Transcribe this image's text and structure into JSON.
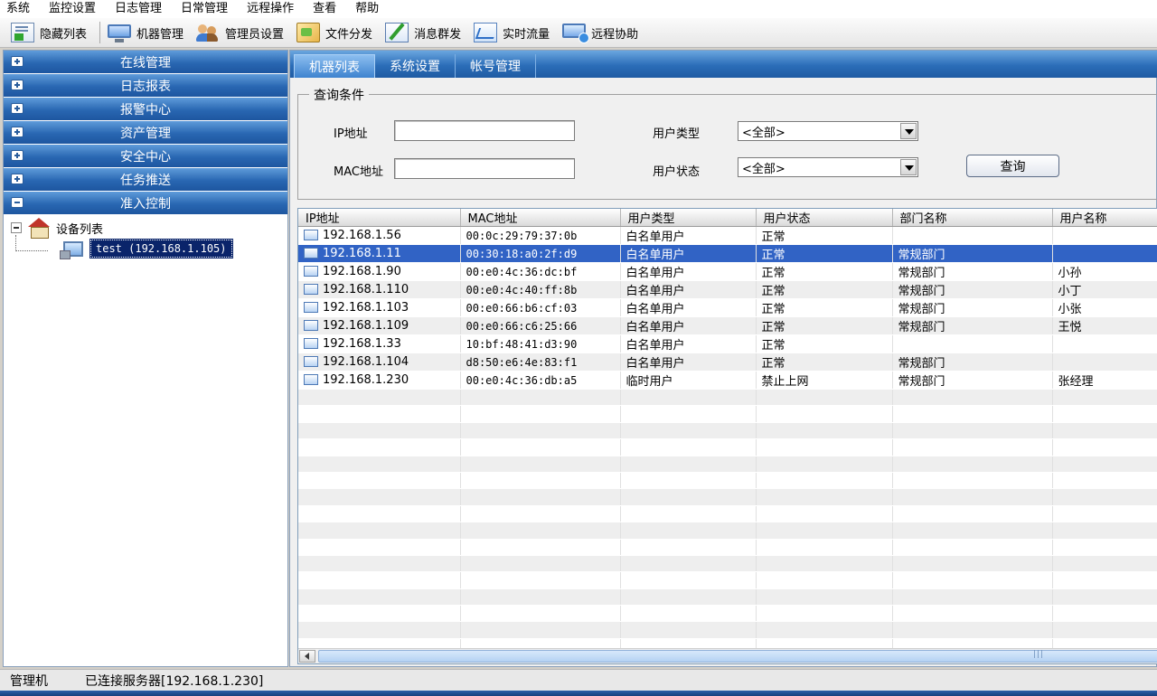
{
  "menu": [
    "系统",
    "监控设置",
    "日志管理",
    "日常管理",
    "远程操作",
    "查看",
    "帮助"
  ],
  "toolbar": {
    "items": [
      {
        "label": "隐藏列表",
        "icon": "hide-list-icon"
      },
      {
        "label": "机器管理",
        "icon": "machine-icon"
      },
      {
        "label": "管理员设置",
        "icon": "admin-users-icon"
      },
      {
        "label": "文件分发",
        "icon": "file-distribute-icon"
      },
      {
        "label": "消息群发",
        "icon": "message-icon"
      },
      {
        "label": "实时流量",
        "icon": "traffic-chart-icon"
      },
      {
        "label": "远程协助",
        "icon": "remote-assist-icon"
      }
    ]
  },
  "sidebar": {
    "sections": [
      {
        "label": "在线管理",
        "expanded": false
      },
      {
        "label": "日志报表",
        "expanded": false
      },
      {
        "label": "报警中心",
        "expanded": false
      },
      {
        "label": "资产管理",
        "expanded": false
      },
      {
        "label": "安全中心",
        "expanded": false
      },
      {
        "label": "任务推送",
        "expanded": false
      },
      {
        "label": "准入控制",
        "expanded": true
      }
    ],
    "tree": {
      "root": "设备列表",
      "child": "test (192.168.1.105)"
    }
  },
  "tabs": [
    "机器列表",
    "系统设置",
    "帐号管理"
  ],
  "query": {
    "title": "查询条件",
    "ip_label": "IP地址",
    "ip_value": "",
    "mac_label": "MAC地址",
    "mac_value": "",
    "user_type_label": "用户类型",
    "user_type_value": "<全部>",
    "user_status_label": "用户状态",
    "user_status_value": "<全部>",
    "search_button": "查询"
  },
  "table": {
    "columns": [
      "IP地址",
      "MAC地址",
      "用户类型",
      "用户状态",
      "部门名称",
      "用户名称"
    ],
    "selected_row": 1,
    "rows": [
      [
        "192.168.1.56",
        "00:0c:29:79:37:0b",
        "白名单用户",
        "正常",
        "",
        ""
      ],
      [
        "192.168.1.11",
        "00:30:18:a0:2f:d9",
        "白名单用户",
        "正常",
        "常规部门",
        ""
      ],
      [
        "192.168.1.90",
        "00:e0:4c:36:dc:bf",
        "白名单用户",
        "正常",
        "常规部门",
        "小孙"
      ],
      [
        "192.168.1.110",
        "00:e0:4c:40:ff:8b",
        "白名单用户",
        "正常",
        "常规部门",
        "小丁"
      ],
      [
        "192.168.1.103",
        "00:e0:66:b6:cf:03",
        "白名单用户",
        "正常",
        "常规部门",
        "小张"
      ],
      [
        "192.168.1.109",
        "00:e0:66:c6:25:66",
        "白名单用户",
        "正常",
        "常规部门",
        "王悦"
      ],
      [
        "192.168.1.33",
        "10:bf:48:41:d3:90",
        "白名单用户",
        "正常",
        "",
        ""
      ],
      [
        "192.168.1.104",
        "d8:50:e6:4e:83:f1",
        "白名单用户",
        "正常",
        "常规部门",
        ""
      ],
      [
        "192.168.1.230",
        "00:e0:4c:36:db:a5",
        "临时用户",
        "禁止上网",
        "常规部门",
        "张经理"
      ]
    ]
  },
  "status": {
    "role": "管理机",
    "connection": "已连接服务器[192.168.1.230]"
  }
}
